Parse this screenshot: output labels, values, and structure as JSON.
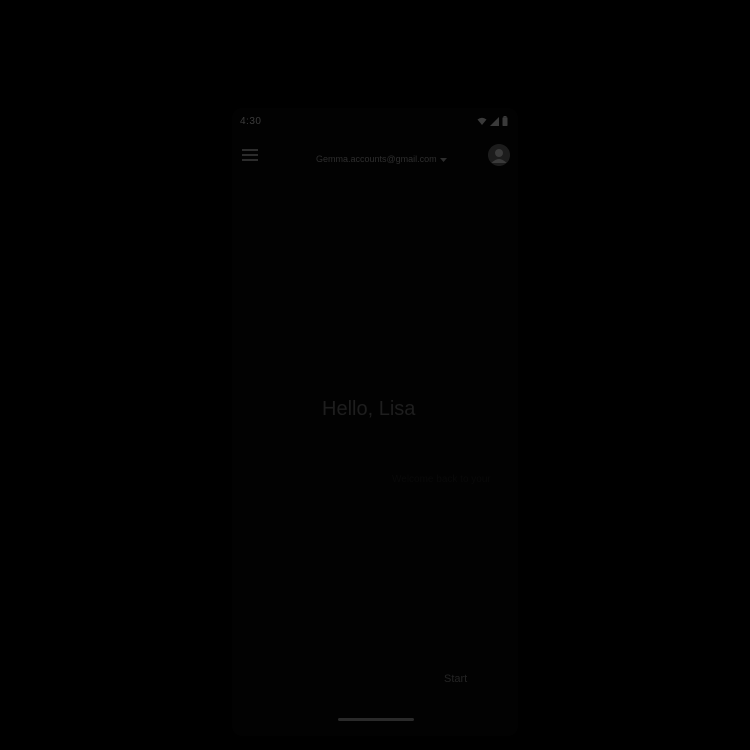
{
  "status_bar": {
    "time": "4:30",
    "icons": [
      "wifi-icon",
      "signal-icon",
      "battery-icon"
    ]
  },
  "app_bar": {
    "menu_icon": "menu-icon",
    "account_email": "Gemma.accounts@gmail.com",
    "dropdown_icon": "chevron-down-icon",
    "avatar_icon": "avatar-icon"
  },
  "main": {
    "greeting": "Hello, Lisa",
    "subtitle": "Welcome back to your",
    "start_label": "Start"
  },
  "colors": {
    "background": "#000000",
    "text_dim": "#2e2e2e"
  }
}
